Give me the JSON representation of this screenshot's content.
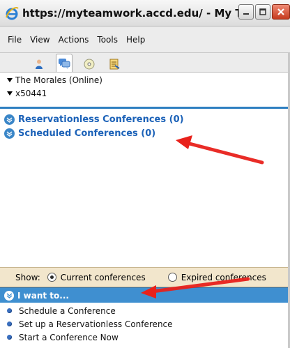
{
  "window": {
    "title": "https://myteamwork.accd.edu/ - My T..."
  },
  "menu": {
    "items": [
      "File",
      "View",
      "Actions",
      "Tools",
      "Help"
    ]
  },
  "tabs": [
    {
      "icon": "person-icon",
      "active": false
    },
    {
      "icon": "conference-icon",
      "active": true
    },
    {
      "icon": "cd-disc-icon",
      "active": false
    },
    {
      "icon": "document-icon",
      "active": false
    }
  ],
  "status": {
    "user": "The Morales (Online)",
    "extension": "x50441"
  },
  "conferences": {
    "reservationless": "Reservationless Conferences (0)",
    "scheduled": "Scheduled Conferences (0)"
  },
  "filter": {
    "show_label": "Show:",
    "current_label": "Current conferences",
    "expired_label": "Expired conferences",
    "selected": "current"
  },
  "iwant": {
    "title": "I want to...",
    "items": [
      "Schedule a Conference",
      "Set up a Reservationless Conference",
      "Start a Conference Now"
    ]
  },
  "colors": {
    "accent_blue": "#3f8fd0",
    "link_blue": "#1c62b8",
    "annotation_red": "#e8211b",
    "filter_bg": "#f2e6cc"
  }
}
